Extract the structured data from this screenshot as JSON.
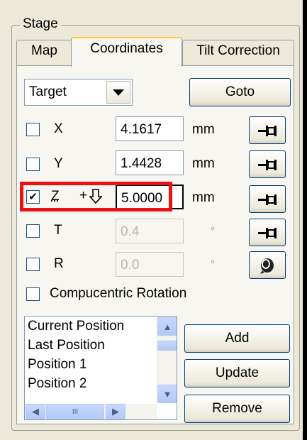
{
  "group": {
    "label": "Stage"
  },
  "tabs": [
    {
      "label": "Map",
      "active": false
    },
    {
      "label": "Coordinates",
      "active": true
    },
    {
      "label": "Tilt Correction",
      "active": false
    }
  ],
  "target": {
    "selected": "Target",
    "goto_label": "Goto"
  },
  "axes": [
    {
      "name": "X",
      "checked": false,
      "value": "4.1617",
      "unit": "mm",
      "enabled": true
    },
    {
      "name": "Y",
      "checked": false,
      "value": "1.4428",
      "unit": "mm",
      "enabled": true
    },
    {
      "name": "Z",
      "checked": true,
      "prefix": "+",
      "value": "5.0000",
      "unit": "mm",
      "enabled": true
    },
    {
      "name": "T",
      "checked": false,
      "value": "0.4",
      "unit": "°",
      "enabled": false
    },
    {
      "name": "R",
      "checked": false,
      "value": "0.0",
      "unit": "°",
      "enabled": false
    }
  ],
  "compucentric": {
    "label": "Compucentric Rotation",
    "checked": false
  },
  "positions": {
    "items": [
      "Current Position",
      "Last Position",
      "Position 1",
      "Position 2"
    ]
  },
  "buttons": {
    "add": "Add",
    "update": "Update",
    "remove": "Remove"
  },
  "highlight_color": "#ee1111",
  "scroll_thumb_label": "III"
}
